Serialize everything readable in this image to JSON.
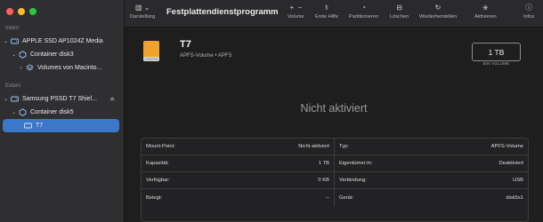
{
  "colors": {
    "close": "#ff5f57",
    "minimize": "#febc2e",
    "zoom": "#28c840",
    "accent": "#3b78c9",
    "drive_orange": "#f0a22c"
  },
  "app": {
    "title": "Festplattendienstprogramm"
  },
  "sidebar": {
    "sections": [
      {
        "label": "Intern"
      },
      {
        "label": "Extern"
      }
    ],
    "items": [
      {
        "label": "APPLE SSD AP1024Z Media",
        "icon": "disk-icon"
      },
      {
        "label": "Container disk3",
        "icon": "container-icon"
      },
      {
        "label": "Volumes von Macinto...",
        "icon": "volume-stack-icon"
      },
      {
        "label": "Samsung PSSD T7 Shiel...",
        "icon": "disk-icon"
      },
      {
        "label": "Container disk5",
        "icon": "container-icon"
      },
      {
        "label": "T7",
        "icon": "volume-icon"
      }
    ]
  },
  "toolbar": {
    "view_label": "Darstellung",
    "volume_label": "Volume",
    "firstaid_label": "Erste Hilfe",
    "partition_label": "Partitionieren",
    "erase_label": "Löschen",
    "restore_label": "Wiederherstellen",
    "activate_label": "Aktivieren",
    "info_label": "Infos"
  },
  "volume": {
    "name": "T7",
    "subtitle": "APFS-Volume • APFS",
    "size": "1 TB",
    "size_caption": "EIN VOLUME",
    "status": "Nicht aktiviert"
  },
  "info": {
    "rows": [
      {
        "lk": "Mount-Point:",
        "lv": "Nicht aktiviert",
        "rk": "Typ:",
        "rv": "APFS-Volume"
      },
      {
        "lk": "Kapazität:",
        "lv": "1 TB",
        "rk": "Eigentümer:in:",
        "rv": "Deaktiviert"
      },
      {
        "lk": "Verfügbar:",
        "lv": "0 KB",
        "rk": "Verbindung:",
        "rv": "USB"
      },
      {
        "lk": "Belegt:",
        "lv": "--",
        "rk": "Gerät:",
        "rv": "disk5s1"
      }
    ]
  }
}
